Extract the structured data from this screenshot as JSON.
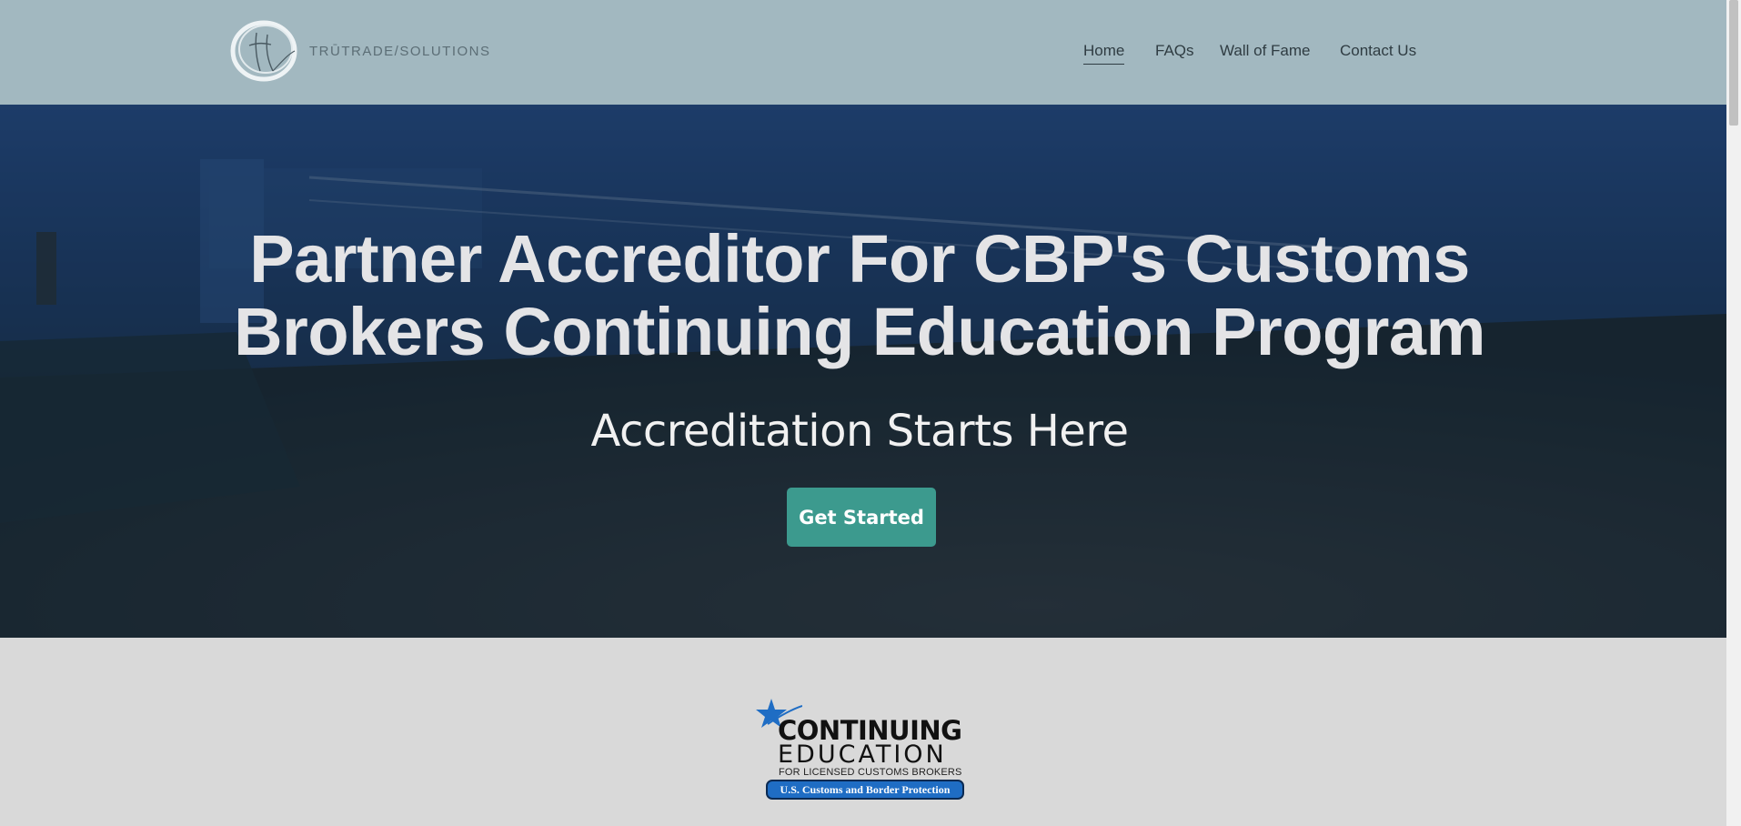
{
  "header": {
    "logo_text": "TRŪTRADE/SOLUTIONS",
    "logo_monogram": "tt",
    "nav": [
      {
        "label": "Home",
        "active": true
      },
      {
        "label": "FAQs",
        "active": false
      },
      {
        "label": "Wall of Fame",
        "active": false
      },
      {
        "label": "Contact Us",
        "active": false
      }
    ]
  },
  "hero": {
    "title": "Partner Accreditor For CBP's Customs Brokers Continuing Education Program",
    "subtitle": "Accreditation Starts Here",
    "cta_label": "Get Started"
  },
  "badge": {
    "line1": "CONTINUING",
    "line2": "EDUCATION",
    "line3": "FOR LICENSED CUSTOMS BROKERS",
    "pill": "U.S. Customs and Border Protection"
  },
  "colors": {
    "header_bg": "#a2b8c0",
    "cta_bg": "#3c9a8e",
    "page_bg": "#d9d9d9",
    "badge_blue": "#1f6dc4"
  },
  "icons": {
    "logo": "tt-monogram-circle-icon",
    "badge_star": "star-icon"
  }
}
